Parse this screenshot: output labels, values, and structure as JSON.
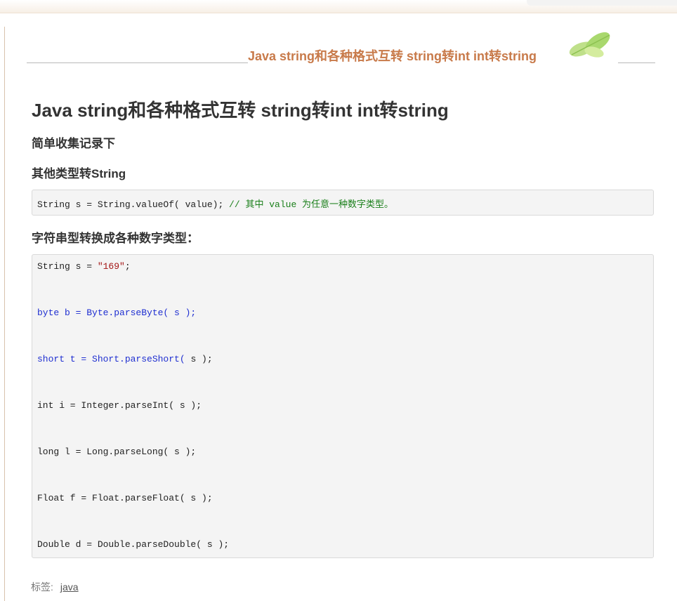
{
  "post": {
    "banner_title": "Java string和各种格式互转 string转int int转string",
    "title": "Java string和各种格式互转 string转int int转string",
    "intro": "简单收集记录下",
    "section1_heading": "其他类型转String",
    "section1_code": {
      "code": "String s = String.valueOf( value); ",
      "comment": "// 其中 value 为任意一种数字类型。"
    },
    "section2_heading": "字符串型转换成各种数字类型：",
    "section2_code": {
      "line1_pre": "String s = ",
      "line1_str": "\"169\"",
      "line1_post": ";",
      "line2": "byte b = Byte.parseByte( s );",
      "line3_kw": "short t = Short.parseShort(",
      "line3_rest": " s );",
      "line4": "int i = Integer.parseInt( s );",
      "line5": "long l = Long.parseLong( s );",
      "line6": "Float f = Float.parseFloat( s );",
      "line7": "Double d = Double.parseDouble( s );"
    },
    "tags_label": "标签:",
    "tags": [
      "java"
    ]
  },
  "colors": {
    "banner_title": "#c87a4a",
    "keyword_blue": "#1f2fd1",
    "string_red": "#a31515",
    "comment_green": "#1a7f1a",
    "code_bg": "#f4f4f4"
  },
  "icons": {
    "banner_decoration": "leaf-icon"
  }
}
